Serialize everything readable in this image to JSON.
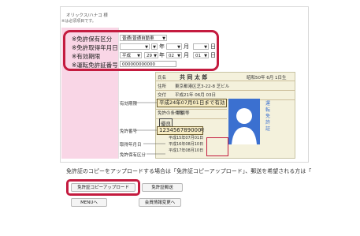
{
  "header": {
    "title": "オリックス/ハナコ 様",
    "note": "※は必須項目です。"
  },
  "form": {
    "license_color": {
      "label": "※免許保有区分",
      "value": "普通(普通自動車"
    },
    "acquired_date": {
      "label": "※免許取得年月日",
      "era": "",
      "year_unit": "年",
      "month_unit": "月",
      "day_unit": "日"
    },
    "valid_until": {
      "label": "※有効期限",
      "era": "平成",
      "year": "29",
      "year_unit": "年",
      "month": "02",
      "month_unit": "月",
      "day": "01",
      "day_unit": "日"
    },
    "license_number": {
      "label": "※運転免許証番号",
      "value": "000000000000"
    }
  },
  "license_card": {
    "name_label": "氏名",
    "name_value": "共 同 太 郎",
    "birth_text": "昭和50年 6月 1日生",
    "address_label": "住所",
    "address_value": "東京都港区芝3-22-8 芝ビル",
    "issue_label": "交付",
    "issue_value": "平成21年 06月 03日",
    "valid_callout": "平成24年07月01日まで有効",
    "condition_label": "免許の条件等",
    "condition_value": "眼鏡等",
    "good_badge": "優良",
    "side_text": "運転免許証",
    "number_callout": "123456789000",
    "number_suffix": "号",
    "acq_dates": [
      "平成15年07月01日",
      "平成16年08月10日",
      "平成17年08月10日"
    ]
  },
  "pointer_labels": {
    "valid": "有効期限",
    "number": "免許番号",
    "acquired": "取得年月日",
    "type": "免許保有区分"
  },
  "bottom": {
    "note": "免許証のコピーをアップロードする場合は「免許証コピーアップロード」、郵送を希望される方は「",
    "upload_button": "免許証コピーアップロード",
    "mail_button": "免許証郵送",
    "menu_button": "MENUへ",
    "change_button": "会員情報変更へ"
  },
  "colors": {
    "highlight": "#c41b3f",
    "pink": "#f9d6e6",
    "avatar": "#3b70d0"
  }
}
